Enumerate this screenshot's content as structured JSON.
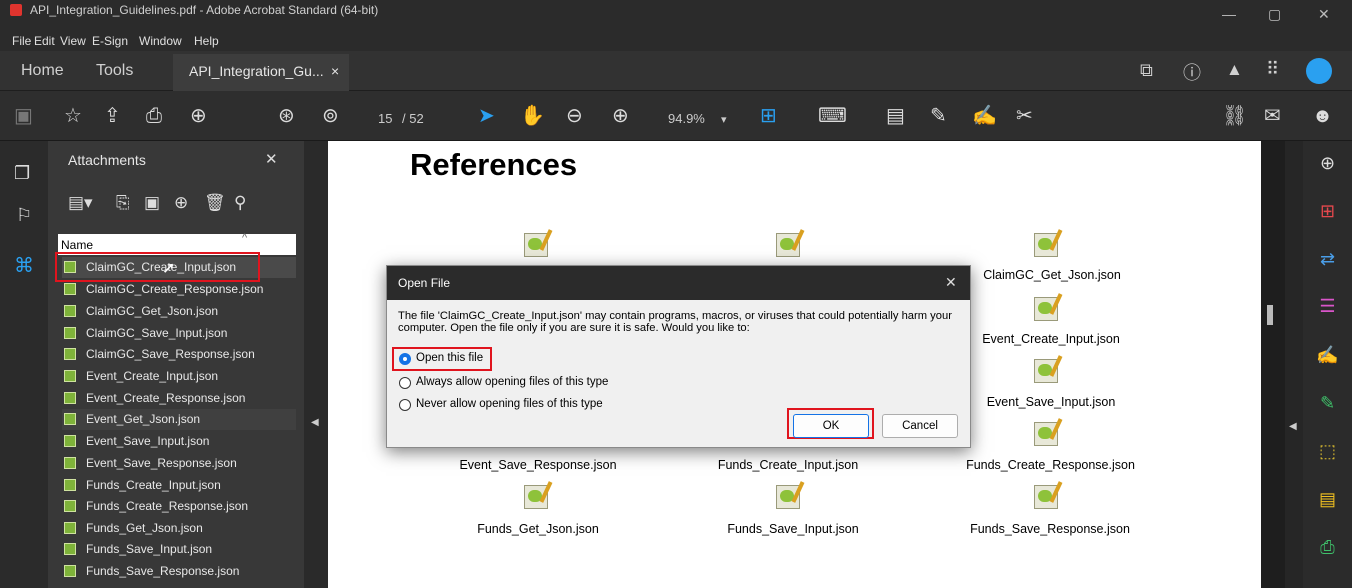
{
  "window": {
    "title": "API_Integration_Guidelines.pdf - Adobe Acrobat Standard (64-bit)",
    "minimize": "—",
    "restore": "▢",
    "close": "✕"
  },
  "menu": [
    "File",
    "Edit",
    "View",
    "E-Sign",
    "Window",
    "Help"
  ],
  "tabs": {
    "home": "Home",
    "tools": "Tools",
    "document": "API_Integration_Gu...",
    "close": "×"
  },
  "toolbar": {
    "page_current": "15",
    "page_total": "/ 52",
    "zoom": "94.9%",
    "zoom_caret": "▾"
  },
  "attachments": {
    "title": "Attachments",
    "close": "✕",
    "column_header": "Name",
    "items": [
      "ClaimGC_Create_Input.json",
      "ClaimGC_Create_Response.json",
      "ClaimGC_Get_Json.json",
      "ClaimGC_Save_Input.json",
      "ClaimGC_Save_Response.json",
      "Event_Create_Input.json",
      "Event_Create_Response.json",
      "Event_Get_Json.json",
      "Event_Save_Input.json",
      "Event_Save_Response.json",
      "Funds_Create_Input.json",
      "Funds_Create_Response.json",
      "Funds_Get_Json.json",
      "Funds_Save_Input.json",
      "Funds_Save_Response.json"
    ]
  },
  "document": {
    "heading": "References",
    "files": {
      "claimgc_get": "ClaimGC_Get_Json.json",
      "event_create_input": "Event_Create_Input.json",
      "event_save_input": "Event_Save_Input.json",
      "event_save_response": "Event_Save_Response.json",
      "funds_create_input": "Funds_Create_Input.json",
      "funds_create_response": "Funds_Create_Response.json",
      "funds_get": "Funds_Get_Json.json",
      "funds_save_input": "Funds_Save_Input.json",
      "funds_save_response": "Funds_Save_Response.json"
    }
  },
  "dialog": {
    "title": "Open File",
    "close": "✕",
    "message": "The file 'ClaimGC_Create_Input.json' may contain programs, macros, or viruses that could potentially harm your computer. Open the file only if you are sure it is safe. Would you like to:",
    "options": [
      "Open this file",
      "Always allow opening files of this type",
      "Never allow opening files of this type"
    ],
    "selected": "Open this file",
    "ok": "OK",
    "cancel": "Cancel"
  },
  "colors": {
    "accent": "#1473e6",
    "highlight": "#e0141e"
  }
}
